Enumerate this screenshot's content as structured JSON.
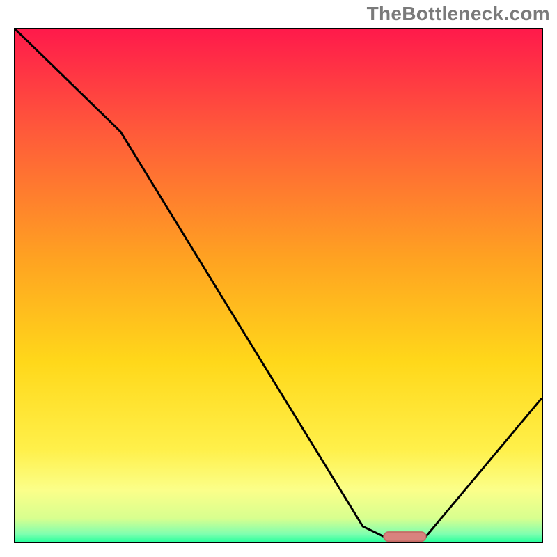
{
  "watermark": "TheBottleneck.com",
  "colors": {
    "border": "#000000",
    "curve": "#000000",
    "marker_fill": "#d9827e",
    "marker_stroke": "#c46b66",
    "gradient_stops": [
      {
        "offset": 0.0,
        "color": "#ff1a4b"
      },
      {
        "offset": 0.2,
        "color": "#ff5a3a"
      },
      {
        "offset": 0.45,
        "color": "#ffa321"
      },
      {
        "offset": 0.65,
        "color": "#ffd81a"
      },
      {
        "offset": 0.82,
        "color": "#fff04a"
      },
      {
        "offset": 0.9,
        "color": "#fbff8a"
      },
      {
        "offset": 0.955,
        "color": "#d7ff8f"
      },
      {
        "offset": 0.985,
        "color": "#7fffb0"
      },
      {
        "offset": 1.0,
        "color": "#2bff9e"
      }
    ]
  },
  "chart_data": {
    "type": "line",
    "title": "",
    "xlabel": "",
    "ylabel": "",
    "xlim": [
      0,
      100
    ],
    "ylim": [
      0,
      100
    ],
    "x": [
      0,
      20,
      66,
      70,
      78,
      100
    ],
    "values": [
      100,
      80,
      3,
      1,
      1,
      28
    ],
    "optimum_range": {
      "x_start": 70,
      "x_end": 78,
      "y": 1
    },
    "annotations": []
  }
}
